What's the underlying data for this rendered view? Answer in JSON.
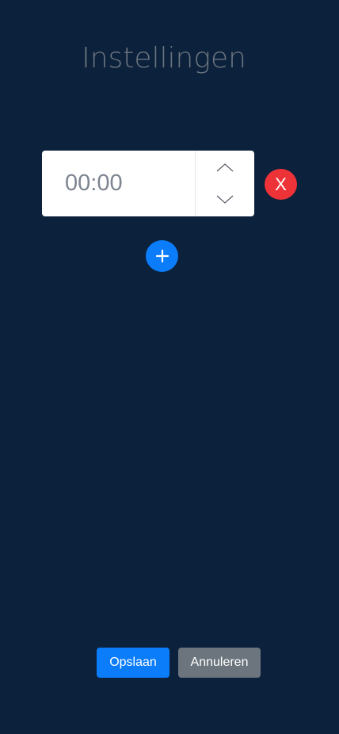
{
  "page": {
    "title": "Instellingen"
  },
  "time_entry": {
    "placeholder": "00:00",
    "remove_label": "X",
    "up_icon": "chevron-up-icon",
    "down_icon": "chevron-down-icon"
  },
  "add": {
    "icon": "plus-icon"
  },
  "actions": {
    "save_label": "Opslaan",
    "cancel_label": "Annuleren"
  },
  "colors": {
    "background": "#0c213b",
    "primary": "#0b7dfb",
    "danger": "#ee3338",
    "secondary": "#6c757d"
  }
}
